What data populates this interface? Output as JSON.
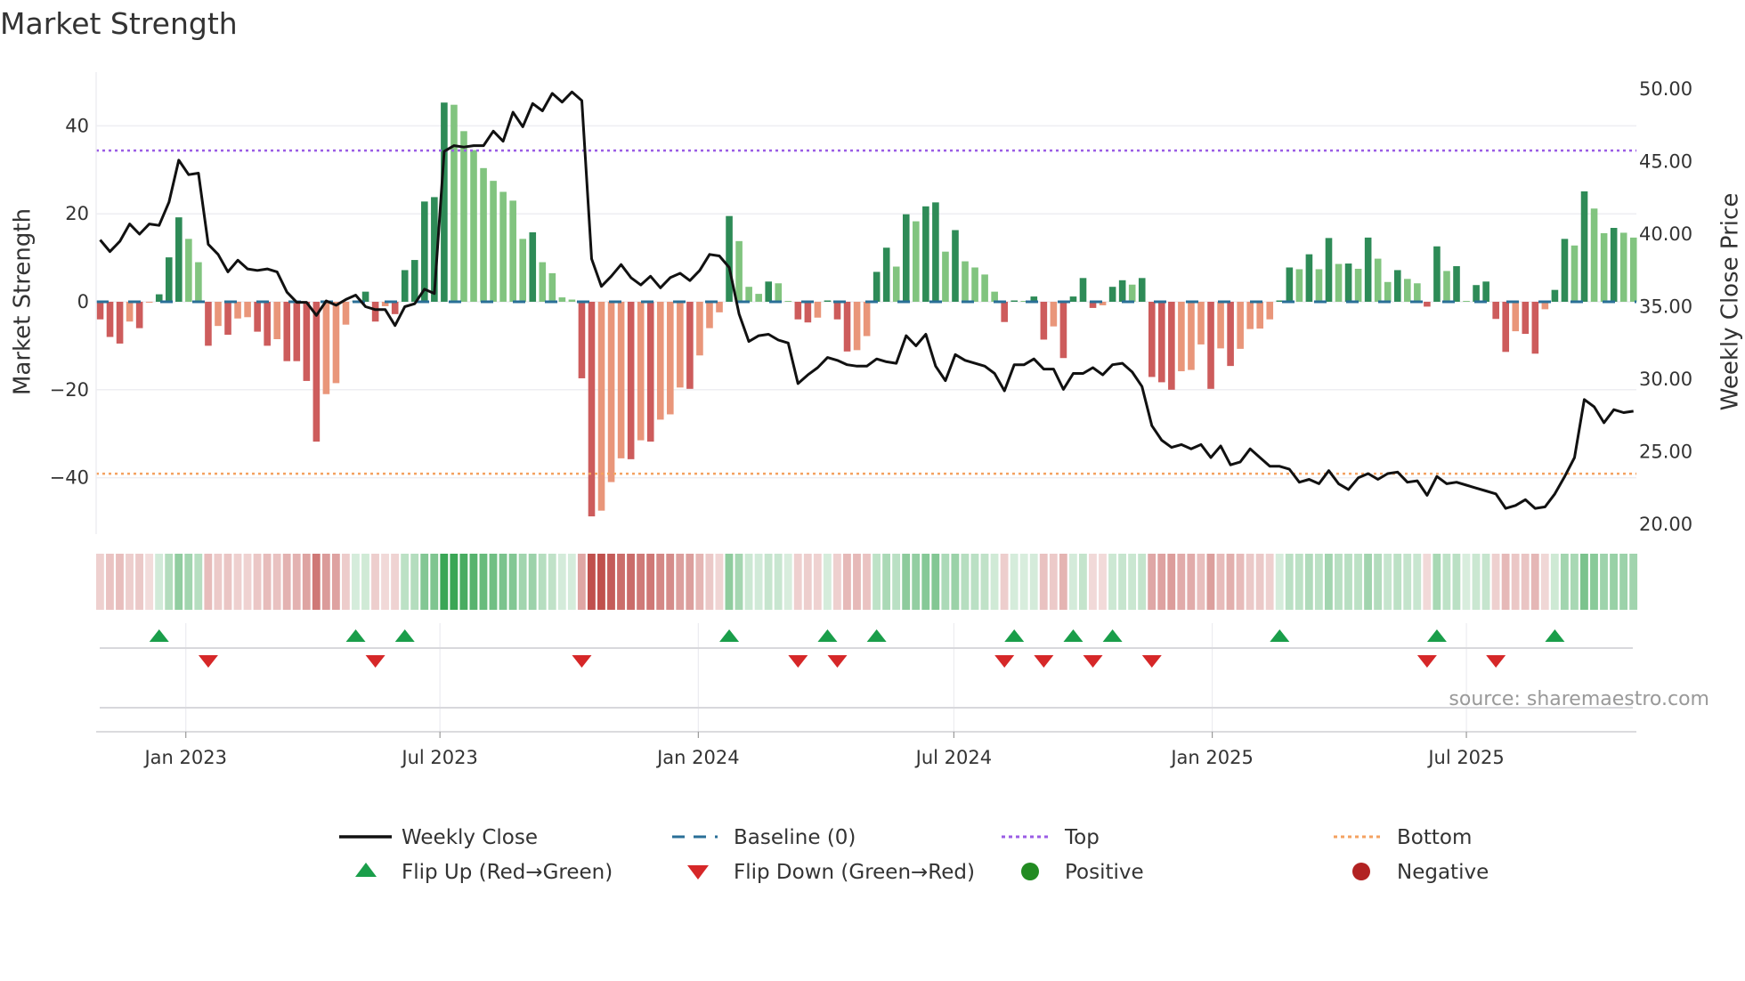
{
  "title": "Market Strength",
  "source": "source: sharemaestro.com",
  "legend": {
    "weekly_close": "Weekly Close",
    "baseline": "Baseline (0)",
    "top": "Top",
    "bottom": "Bottom",
    "flip_up": "Flip Up (Red→Green)",
    "flip_down": "Flip Down (Green→Red)",
    "positive": "Positive",
    "negative": "Negative"
  },
  "colors": {
    "dark_green": "#2e8b57",
    "light_green": "#81c47f",
    "dark_red": "#cd5c5c",
    "light_red": "#e9967a",
    "line": "#111111",
    "top": "#9b5de5",
    "bottom": "#f4a261",
    "baseline": "#2a6f97",
    "flip_up": "#1a9e4a",
    "flip_down": "#d62728",
    "positive": "#228b22",
    "negative": "#b22222",
    "heat_green": "#3aa655",
    "heat_red": "#c0504d"
  },
  "chart_data": {
    "type": "bar",
    "title": "Market Strength",
    "ylabel": "Market Strength",
    "ylabel_right": "Weekly Close Price",
    "start_date": "2022-11-01",
    "interval_days": 7,
    "ylim": [
      -52,
      52
    ],
    "ylim_right": [
      18.7,
      51.5
    ],
    "y_ticks": [
      -40,
      -20,
      0,
      20,
      40
    ],
    "y_right_ticks": [
      "20.00",
      "25.00",
      "30.00",
      "35.00",
      "40.00",
      "45.00",
      "50.00"
    ],
    "x_ticks": [
      {
        "label": "Jan 2023",
        "date": "2023-01-01"
      },
      {
        "label": "Jul 2023",
        "date": "2023-07-01"
      },
      {
        "label": "Jan 2024",
        "date": "2024-01-01"
      },
      {
        "label": "Jul 2024",
        "date": "2024-07-01"
      },
      {
        "label": "Jan 2025",
        "date": "2025-01-01"
      },
      {
        "label": "Jul 2025",
        "date": "2025-07-01"
      }
    ],
    "top_level": 34.4,
    "bottom_level": -39.1,
    "baseline": 0,
    "strength": [
      -4,
      -8,
      -9.5,
      -4.5,
      -6,
      -0.2,
      1.7,
      10.1,
      19.2,
      14.3,
      9,
      -10,
      -5.5,
      -7.5,
      -3.8,
      -3.5,
      -6.8,
      -10,
      -8.5,
      -13.5,
      -13.5,
      -18,
      -31.8,
      -21,
      -18.5,
      -5.2,
      0.3,
      2.3,
      -4.5,
      -1,
      -2.8,
      7.2,
      9.5,
      22.8,
      23.8,
      45.3,
      44.8,
      38.8,
      34.5,
      30.4,
      27.5,
      25,
      23,
      14.3,
      15.8,
      9,
      6.5,
      1,
      0.5,
      -17.4,
      -48.8,
      -47.5,
      -41,
      -35.6,
      -35.8,
      -31.5,
      -31.8,
      -26.8,
      -25.6,
      -19.5,
      -19.8,
      -12.2,
      -6,
      -2.4,
      19.5,
      13.8,
      3.4,
      1.8,
      4.6,
      4.2,
      0.2,
      -4,
      -4.7,
      -3.6,
      0.3,
      -4,
      -11.3,
      -11,
      -7.8,
      6.8,
      12.3,
      8,
      19.9,
      18.3,
      21.7,
      22.6,
      11.4,
      16.3,
      9.2,
      7.8,
      6.2,
      2.3,
      -4.6,
      0.3,
      0.2,
      1.2,
      -8.6,
      -5.6,
      -12.8,
      1.2,
      5.4,
      -1.4,
      -0.8,
      3.4,
      4.9,
      3.9,
      5.4,
      -17.1,
      -18.3,
      -20,
      -15.8,
      -15.5,
      -9.7,
      -19.8,
      -10.6,
      -14.6,
      -10.7,
      -6.2,
      -6.1,
      -4,
      0.3,
      7.8,
      7.4,
      10.8,
      7.4,
      14.5,
      8.6,
      8.7,
      7.5,
      14.6,
      9.8,
      4.5,
      7.2,
      5.2,
      4.2,
      -1.1,
      12.6,
      7,
      8.1,
      0.2,
      3.8,
      4.6,
      -3.9,
      -11.4,
      -6.7,
      -7.3,
      -11.8,
      -1.7,
      2.7,
      14.3,
      12.8,
      25.1,
      21.2,
      15.6,
      16.8,
      15.7,
      14.6
    ],
    "weekly_close": [
      39.6,
      38.8,
      39.5,
      40.7,
      40.0,
      40.7,
      40.6,
      42.2,
      45.1,
      44.1,
      44.2,
      39.3,
      38.6,
      37.4,
      38.2,
      37.6,
      37.5,
      37.6,
      37.4,
      36.0,
      35.3,
      35.3,
      34.4,
      35.4,
      35.1,
      35.5,
      35.8,
      35.0,
      34.8,
      34.8,
      33.7,
      35.0,
      35.2,
      36.2,
      35.9,
      45.7,
      46.1,
      46.0,
      46.1,
      46.1,
      47.1,
      46.4,
      48.4,
      47.4,
      49.0,
      48.5,
      49.7,
      49.1,
      49.8,
      49.2,
      38.3,
      36.4,
      37.1,
      37.9,
      37.0,
      36.5,
      37.1,
      36.3,
      37.0,
      37.3,
      36.8,
      37.5,
      38.6,
      38.5,
      37.7,
      34.5,
      32.6,
      33.0,
      33.1,
      32.7,
      32.5,
      29.7,
      30.3,
      30.8,
      31.5,
      31.3,
      31.0,
      30.9,
      30.9,
      31.4,
      31.2,
      31.1,
      33.0,
      32.3,
      33.1,
      30.9,
      29.9,
      31.7,
      31.3,
      31.1,
      30.9,
      30.4,
      29.2,
      31.0,
      31.0,
      31.4,
      30.7,
      30.7,
      29.3,
      30.4,
      30.4,
      30.8,
      30.3,
      31.0,
      31.1,
      30.5,
      29.5,
      26.8,
      25.8,
      25.3,
      25.5,
      25.2,
      25.5,
      24.6,
      25.4,
      24.1,
      24.3,
      25.2,
      24.6,
      24.0,
      24.0,
      23.8,
      22.9,
      23.1,
      22.8,
      23.7,
      22.8,
      22.4,
      23.2,
      23.5,
      23.1,
      23.5,
      23.6,
      22.9,
      23.0,
      22.0,
      23.3,
      22.8,
      22.9,
      22.7,
      22.5,
      22.3,
      22.1,
      21.1,
      21.3,
      21.7,
      21.1,
      21.2,
      22.1,
      23.3,
      24.6,
      28.6,
      28.1,
      27.0,
      27.9,
      27.7,
      27.8
    ],
    "flip_up_dates": [
      "2022-12-13",
      "2023-05-02",
      "2023-06-06",
      "2024-01-23",
      "2024-04-02",
      "2024-05-07",
      "2024-08-13",
      "2024-09-24",
      "2024-10-22",
      "2025-02-18",
      "2025-06-10",
      "2025-09-02"
    ],
    "flip_down_dates": [
      "2023-01-17",
      "2023-05-16",
      "2023-10-10",
      "2024-03-12",
      "2024-04-09",
      "2024-08-06",
      "2024-09-03",
      "2024-10-08",
      "2024-11-19",
      "2025-06-03",
      "2025-07-22"
    ]
  }
}
